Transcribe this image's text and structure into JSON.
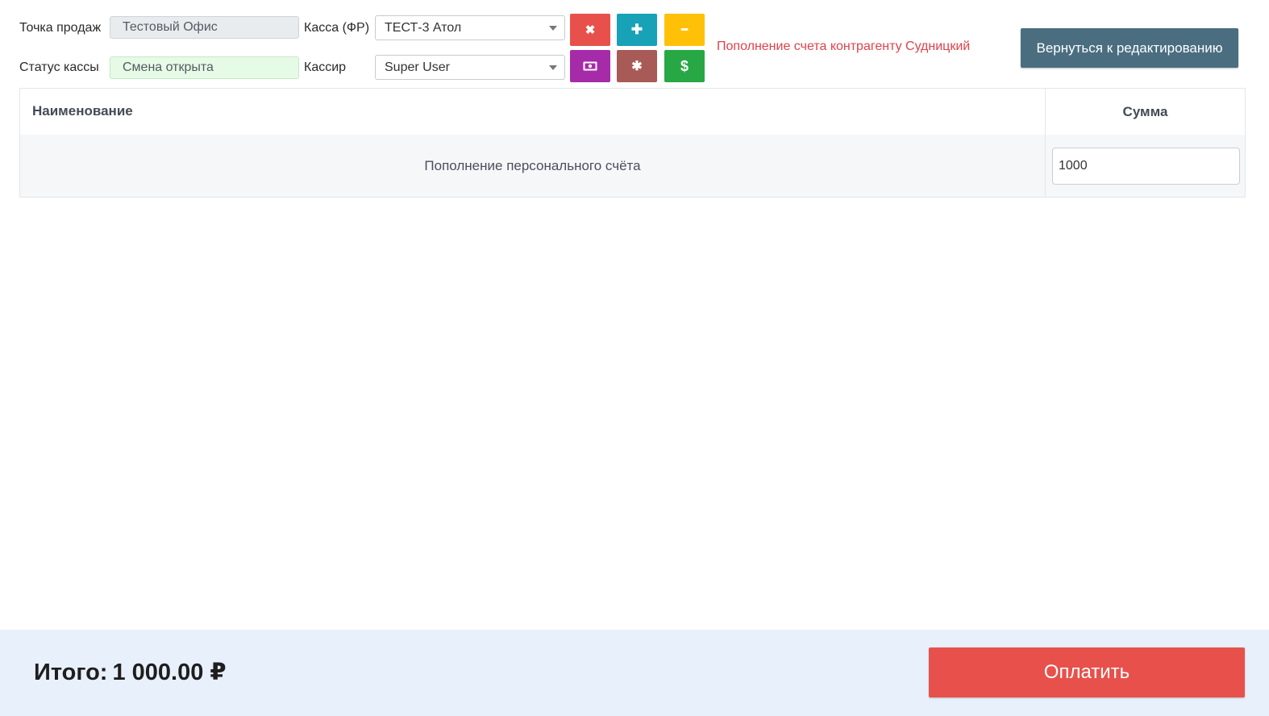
{
  "header": {
    "sale_point_label": "Точка продаж",
    "sale_point_value": "Тестовый Офис",
    "register_label": "Касса (ФР)",
    "register_value": "ТЕСТ-3 Атол",
    "register_status_label": "Статус кассы",
    "register_status_value": "Смена открыта",
    "cashier_label": "Кассир",
    "cashier_value": "Super User",
    "notice": "Пополнение счета контрагенту Судницкий",
    "back_button": "Вернуться к редактированию"
  },
  "tool_buttons": [
    {
      "icon": "close-icon",
      "glyph": "✖",
      "color": "#e8514b"
    },
    {
      "icon": "plus-icon",
      "glyph": "✚",
      "color": "#17a2b8"
    },
    {
      "icon": "minus-icon",
      "glyph": "━",
      "color": "#ffc107"
    },
    {
      "icon": "money-icon",
      "glyph": "",
      "color": "#a62ba8"
    },
    {
      "icon": "gear-icon",
      "glyph": "✱",
      "color": "#a85a57"
    },
    {
      "icon": "dollar-icon",
      "glyph": "$",
      "color": "#28a745"
    }
  ],
  "table": {
    "columns": [
      "Наименование",
      "Сумма"
    ],
    "rows": [
      {
        "name": "Пополнение персонального счёта",
        "amount": "1000"
      }
    ]
  },
  "footer": {
    "total_label": "Итого:",
    "total_value": "1 000.00 ₽",
    "pay_button": "Оплатить"
  },
  "colors": {
    "status_open_bg": "#e6fbe6",
    "readonly_bg": "#e9ecef",
    "notice": "#e0424a",
    "back_button": "#4a6e80",
    "pay_button": "#e8514b",
    "footer_bg": "#e8f0fb"
  }
}
